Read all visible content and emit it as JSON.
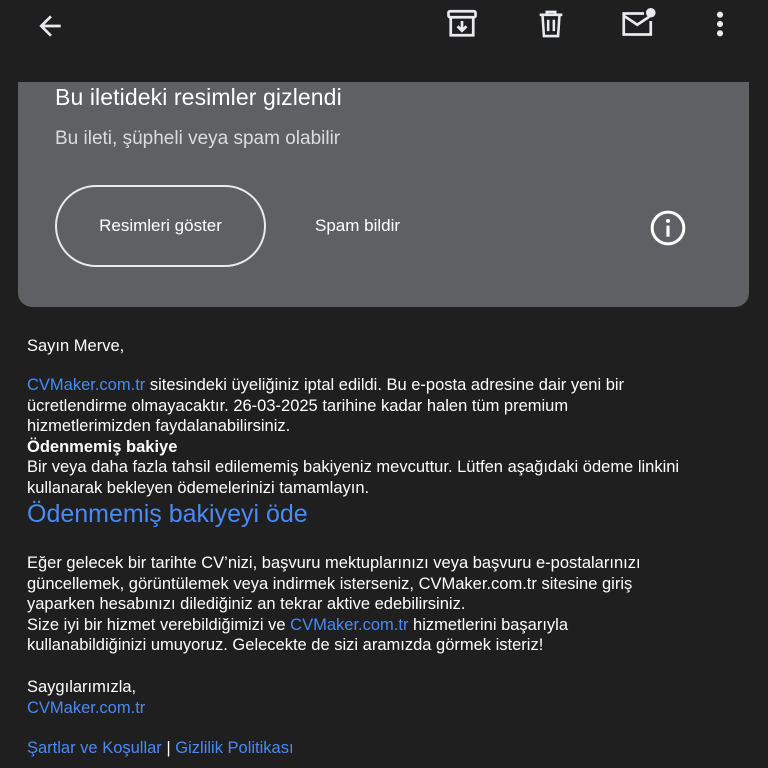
{
  "toolbar": {
    "icons": [
      "back-arrow-icon",
      "archive-icon",
      "trash-icon",
      "mark-unread-icon",
      "more-vert-icon"
    ]
  },
  "banner": {
    "title": "Bu iletideki resimler gizlendi",
    "subtitle": "Bu ileti, şüpheli veya spam olabilir",
    "show_images_label": "Resimleri göster",
    "report_spam_label": "Spam bildir",
    "info_icon": "info-icon"
  },
  "email": {
    "greeting": "Sayın Merve,",
    "p1_link": "CVMaker.com.tr",
    "p1_l1_rest": " sitesindeki üyeliğiniz iptal edildi. Bu e-posta adresine dair yeni bir",
    "p1_l2": "ücretlendirme olmayacaktır. 26-03-2025 tarihine kadar halen tüm premium",
    "p1_l3": "hizmetlerimizden faydalanabilirsiniz.",
    "unpaid_heading": "Ödenmemiş bakiye",
    "unpaid_l1": "Bir veya daha fazla tahsil edilememiş bakiyeniz mevcuttur. Lütfen aşağıdaki ödeme linkini",
    "unpaid_l2": "kullanarak bekleyen ödemelerinizi tamamlayın.",
    "pay_link": "Ödenmemiş bakiyeyi öde",
    "p3_l1": "Eğer gelecek bir tarihte CV’nizi, başvuru mektuplarınızı veya başvuru e-postalarınızı",
    "p3_l2": "güncellemek, görüntülemek veya indirmek isterseniz, CVMaker.com.tr sitesine giriş",
    "p3_l3": "yaparken hesabınızı dilediğiniz an tekrar aktive edebilirsiniz.",
    "p4_l1_pre": "Size iyi bir hizmet verebildiğimizi ve ",
    "p4_l1_link": "CVMaker.com.tr",
    "p4_l1_post": " hizmetlerini başarıyla",
    "p4_l2": "kullanabildiğinizi umuyoruz. Gelecekte de sizi aramızda görmek isteriz!",
    "signoff": "Saygılarımızla,",
    "signoff_link": "CVMaker.com.tr",
    "terms_link": "Şartlar ve Koşullar",
    "separator": " | ",
    "privacy_link": "Gizlilik Politikası"
  },
  "colors": {
    "background": "#1f1f1f",
    "banner": "#5f6063",
    "link": "#4a8af4",
    "icon": "#e8eaed"
  }
}
